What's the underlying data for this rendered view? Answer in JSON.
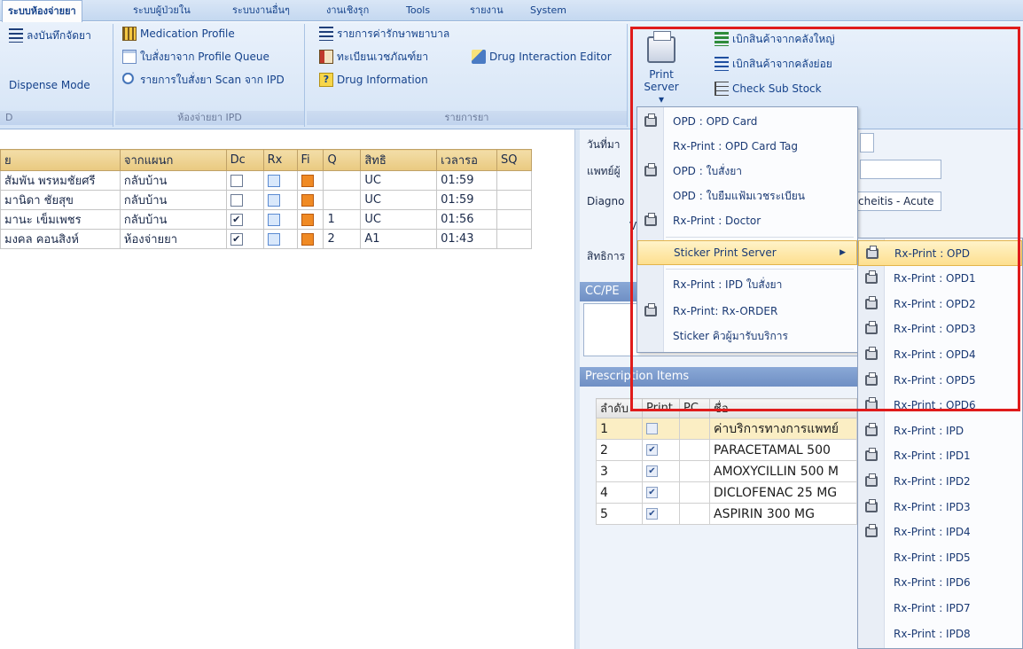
{
  "tabs": [
    {
      "label": "ระบบห้องจ่ายยา",
      "active": true
    },
    {
      "label": "ระบบผู้ป่วยใน"
    },
    {
      "label": "ระบบงานอื่นๆ"
    },
    {
      "label": "งานเชิงรุก"
    },
    {
      "label": "Tools"
    },
    {
      "label": "รายงาน"
    },
    {
      "label": "System"
    }
  ],
  "ribbon": {
    "group1": {
      "item1": "ลงบันทึกจัดยา",
      "item2": "Dispense Mode",
      "label": "D"
    },
    "group2": {
      "item1": "Medication Profile",
      "item2": "ใบสั่งยาจาก Profile Queue",
      "item3": "รายการใบสั่งยา Scan จาก IPD",
      "label": "ห้องจ่ายยา IPD"
    },
    "group3": {
      "item1": "รายการค่ารักษาพยาบาล",
      "item2": "ทะเบียนเวชภัณฑ์ยา",
      "item3": "Drug Interaction Editor",
      "item4": "Drug Information",
      "label": "รายการยา"
    },
    "print_server": {
      "line1": "Print",
      "line2": "Server"
    },
    "group5": {
      "item1": "เบิกสินค้าจากคลังใหญ่",
      "item2": "เบิกสินค้าจากคลังย่อย",
      "item3": "Check Sub Stock"
    }
  },
  "grid": {
    "headers": [
      "ย",
      "จากแผนก",
      "Dc",
      "Rx",
      "Fi",
      "Q",
      "สิทธิ",
      "เวลารอ",
      "SQ"
    ],
    "rows": [
      {
        "name": "สัมพัน พรหมชัยศรี",
        "dept": "กลับบ้าน",
        "dc": false,
        "q": "",
        "right": "UC",
        "wait": "01:59"
      },
      {
        "name": "มานิดา ชัยสุข",
        "dept": "กลับบ้าน",
        "dc": false,
        "q": "",
        "right": "UC",
        "wait": "01:59"
      },
      {
        "name": "มานะ เข็มเพชร",
        "dept": "กลับบ้าน",
        "dc": true,
        "q": "1",
        "right": "UC",
        "wait": "01:56"
      },
      {
        "name": "มงคล คอนสิงห์",
        "dept": "ห้องจ่ายยา",
        "dc": true,
        "q": "2",
        "right": "A1",
        "wait": "01:43"
      }
    ]
  },
  "right_panel": {
    "date_label": "วันที่มา",
    "doctor_label": "แพทย์ผู้",
    "diag_label": "Diagno",
    "v_label": "V",
    "rights_label": "สิทธิการ",
    "diag_value": "cheitis - Acute",
    "cc_pe_label": "CC/PE",
    "rx_items_label": "Prescription Items",
    "rx_headers": [
      "ลำดับ",
      "Print",
      "PC",
      "ชื่อ"
    ],
    "rx_rows": [
      {
        "no": "1",
        "print": false,
        "name": "ค่าบริการทางการแพทย์"
      },
      {
        "no": "2",
        "print": true,
        "name": "PARACETAMAL 500"
      },
      {
        "no": "3",
        "print": true,
        "name": "AMOXYCILLIN 500 M"
      },
      {
        "no": "4",
        "print": true,
        "name": "DICLOFENAC 25 MG"
      },
      {
        "no": "5",
        "print": true,
        "name": "ASPIRIN 300 MG"
      }
    ]
  },
  "print_menu": {
    "items": [
      {
        "label": "OPD : OPD Card",
        "icon": "printer-icon"
      },
      {
        "label": "Rx-Print : OPD Card Tag"
      },
      {
        "label": "OPD : ใบสั่งยา",
        "icon": "printer-icon"
      },
      {
        "label": "OPD : ใบยืมแฟ้มเวชระเบียน"
      },
      {
        "label": "Rx-Print : Doctor",
        "icon": "printer-icon"
      },
      {
        "label": "Sticker Print Server",
        "highlighted": true
      },
      {
        "label": "Rx-Print : IPD ใบสั่งยา"
      },
      {
        "label": "Rx-Print: Rx-ORDER",
        "icon": "printer-icon"
      },
      {
        "label": "Sticker คิวผู้มารับบริการ"
      }
    ]
  },
  "sticker_submenu": {
    "items": [
      "Rx-Print : OPD",
      "Rx-Print : OPD1",
      "Rx-Print : OPD2",
      "Rx-Print : OPD3",
      "Rx-Print : OPD4",
      "Rx-Print : OPD5",
      "Rx-Print : OPD6",
      "Rx-Print : IPD",
      "Rx-Print : IPD1",
      "Rx-Print : IPD2",
      "Rx-Print : IPD3",
      "Rx-Print : IPD4",
      "Rx-Print : IPD5",
      "Rx-Print : IPD6",
      "Rx-Print : IPD7",
      "Rx-Print : IPD8"
    ],
    "highlighted_index": 0,
    "icon_count": 12
  },
  "colors": {
    "accent": "#15428b",
    "highlight": "#fddf8f",
    "annotation_box": "#e01b1b"
  }
}
